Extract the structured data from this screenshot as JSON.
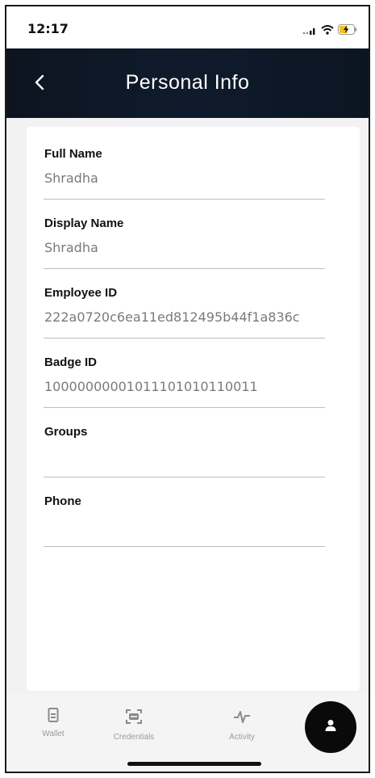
{
  "status_bar": {
    "time": "12:17"
  },
  "header": {
    "title": "Personal Info"
  },
  "fields": [
    {
      "label": "Full Name",
      "value": "Shradha"
    },
    {
      "label": "Display Name",
      "value": "Shradha"
    },
    {
      "label": "Employee ID",
      "value": "222a0720c6ea11ed812495b44f1a836c"
    },
    {
      "label": "Badge ID",
      "value": "10000000001011101010110011"
    },
    {
      "label": "Groups",
      "value": ""
    },
    {
      "label": "Phone",
      "value": ""
    }
  ],
  "nav": {
    "items": [
      {
        "label": "Wallet",
        "icon": "wallet-icon"
      },
      {
        "label": "Credentials",
        "icon": "credentials-icon"
      },
      {
        "label": "Activity",
        "icon": "activity-icon"
      }
    ],
    "active": "profile-icon"
  },
  "colors": {
    "header": "#0f1b2c",
    "accent": "#0a0a0a",
    "muted": "#9a9a9a"
  }
}
